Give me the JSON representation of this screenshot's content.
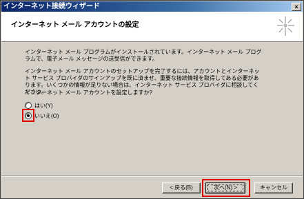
{
  "window": {
    "title": "インターネット接続ウィザード",
    "close_glyph": "×"
  },
  "header": {
    "title": "インターネット メール アカウントの設定",
    "icon": "wizard-sparkle-icon"
  },
  "content": {
    "paragraph1": "インターネット メール プログラムがインストールされています。インターネット メール プログラムで、電子メール メッセージの送受信ができます。",
    "paragraph2": "インターネット メール アカウントのセットアップを完了するには、アカウントとインターネット サービス プロバイダのサインアップを既に済ませ、重要な接続情報を取得してある必要があります。いくつかの情報が足りない場合は、インターネット サービス プロバイダに相談してください。",
    "question": "インターネット メール アカウントを設定しますか?",
    "options": [
      {
        "label": "はい(Y)",
        "checked": false
      },
      {
        "label": "いいえ(O)",
        "checked": true
      }
    ]
  },
  "buttons": {
    "back": "< 戻る(B)",
    "next": "次へ(N) >",
    "cancel": "キャンセル"
  },
  "highlight_color": "#e00000"
}
